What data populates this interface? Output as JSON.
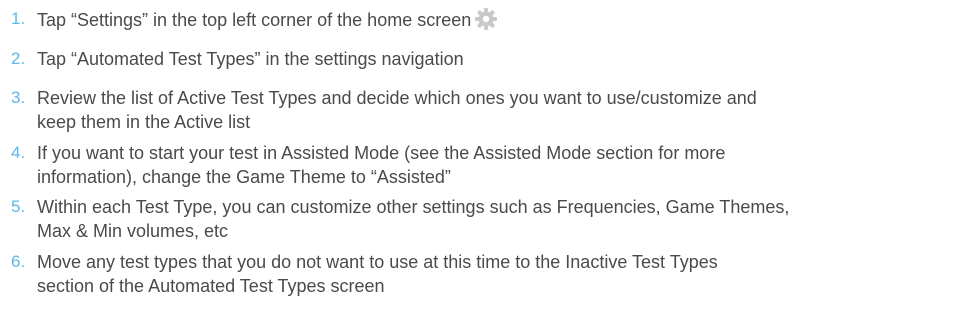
{
  "steps": [
    {
      "num": "1.",
      "lines": [
        "Tap “Settings” in the top left corner of the home screen"
      ],
      "icon": "gear-icon"
    },
    {
      "num": "2.",
      "lines": [
        "Tap “Automated Test Types” in the settings navigation"
      ]
    },
    {
      "num": "3.",
      "lines": [
        "Review the list of Active Test Types and decide which ones you want to use/customize and",
        "keep them in the Active list"
      ]
    },
    {
      "num": "4.",
      "lines": [
        "If you want to start your test in Assisted Mode (see the Assisted Mode section for more",
        "information), change the Game Theme to “Assisted”"
      ]
    },
    {
      "num": "5.",
      "lines": [
        "Within each Test Type, you can customize other settings such as Frequencies, Game Themes,",
        "Max & Min volumes, etc"
      ]
    },
    {
      "num": "6.",
      "lines": [
        "Move any test types that you do not want to use at this time to the Inactive Test Types",
        "section of the Automated Test Types screen"
      ]
    }
  ],
  "colors": {
    "number": "#5bb8e8",
    "text": "#4a4a4a",
    "icon": "#c9c9c9"
  }
}
